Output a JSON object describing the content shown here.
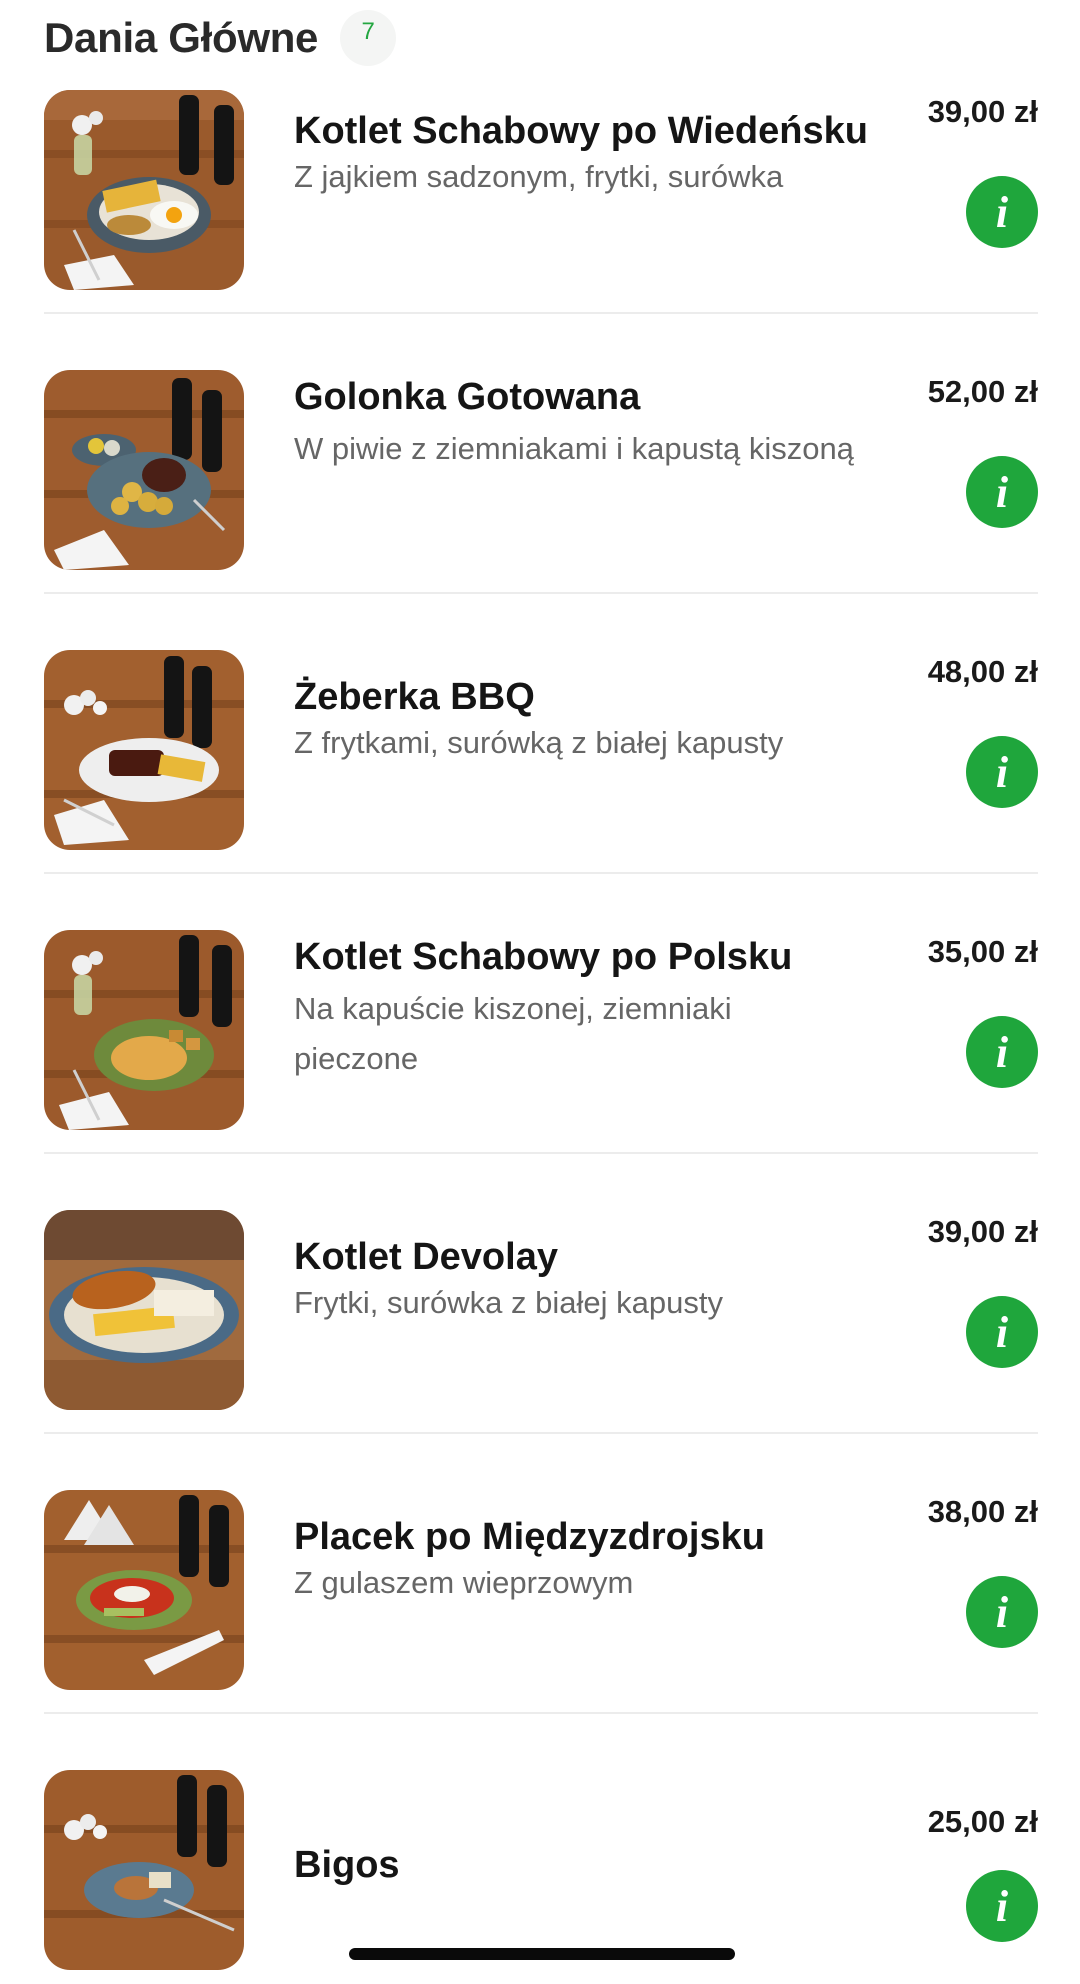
{
  "section": {
    "title": "Dania Główne",
    "count": "7"
  },
  "colors": {
    "accent_green": "#1fa63c",
    "badge_text_green": "#23a640"
  },
  "info_icon": "info-italic-i",
  "items": [
    {
      "name": "Kotlet Schabowy po Wiedeńsku",
      "desc": "Z jajkiem sadzonym, frytki, surówka",
      "price": "39,00 zł",
      "info": "i"
    },
    {
      "name": "Golonka Gotowana",
      "desc": "W piwie z ziemniakami i kapustą kiszoną",
      "price": "52,00 zł",
      "info": "i"
    },
    {
      "name": "Żeberka BBQ",
      "desc": "Z frytkami, surówką z białej kapusty",
      "price": "48,00 zł",
      "info": "i"
    },
    {
      "name": "Kotlet Schabowy po Polsku",
      "desc": "Na kapuście kiszonej, ziemniaki pieczone",
      "price": "35,00 zł",
      "info": "i"
    },
    {
      "name": "Kotlet Devolay",
      "desc": "Frytki, surówka z białej kapusty",
      "price": "39,00 zł",
      "info": "i"
    },
    {
      "name": "Placek po Międzyzdrojsku",
      "desc": "Z gulaszem wieprzowym",
      "price": "38,00 zł",
      "info": "i"
    },
    {
      "name": "Bigos",
      "desc": "",
      "price": "25,00 zł",
      "info": "i"
    }
  ]
}
